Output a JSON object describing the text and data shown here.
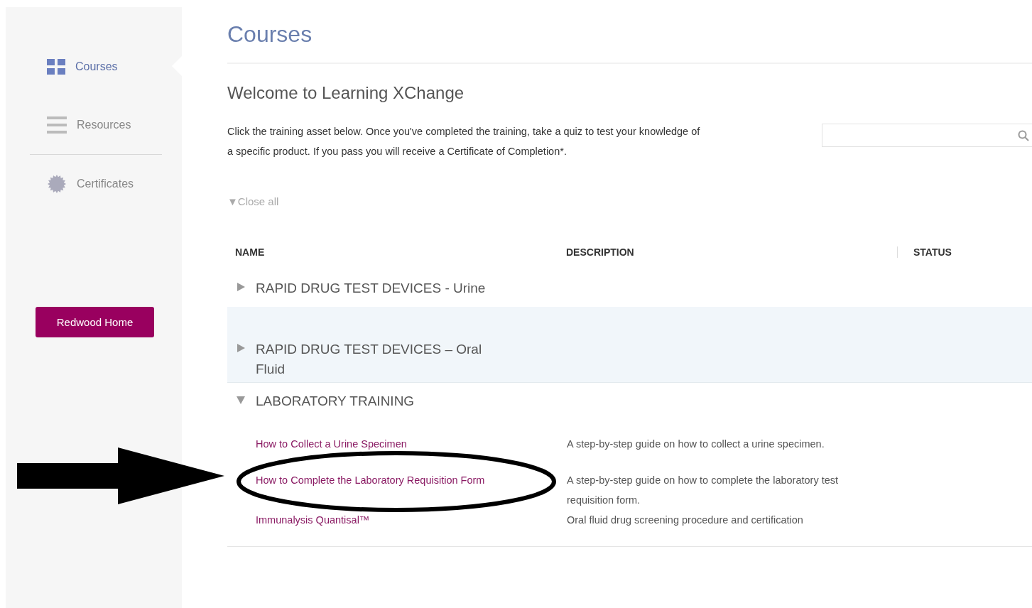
{
  "sidebar": {
    "items": [
      {
        "label": "Courses",
        "kind": "grid",
        "selected": true
      },
      {
        "label": "Resources",
        "kind": "lines",
        "selected": false
      },
      {
        "label": "Certificates",
        "kind": "seal",
        "selected": false
      }
    ],
    "button": "Redwood Home"
  },
  "page_title": "Courses",
  "welcome": "Welcome to Learning XChange",
  "intro": "Click the training asset below. Once you've completed the training, take a quiz to test your knowledge of a specific product. If you pass you will receive a Certificate of Completion*.",
  "close_all": "▼Close all",
  "table": {
    "columns": [
      "NAME",
      "DESCRIPTION",
      "STATUS"
    ],
    "groups": [
      {
        "title": "RAPID DRUG TEST DEVICES - Urine",
        "expanded": false,
        "highlighted": false
      },
      {
        "title": "RAPID DRUG TEST DEVICES – Oral Fluid",
        "expanded": false,
        "highlighted": true
      },
      {
        "title": "LABORATORY TRAINING",
        "expanded": true,
        "highlighted": false,
        "children": [
          {
            "name": "How to Collect a Urine Specimen",
            "description": "A step-by-step guide on how to collect a urine specimen."
          },
          {
            "name": "How to Complete the Laboratory Requisition Form",
            "description": "A step-by-step guide on how to complete the laboratory test requisition form.",
            "circled": true
          },
          {
            "name": "Immunalysis Quantisal™",
            "description": "Oral fluid drug screening procedure and certification"
          }
        ]
      }
    ]
  }
}
